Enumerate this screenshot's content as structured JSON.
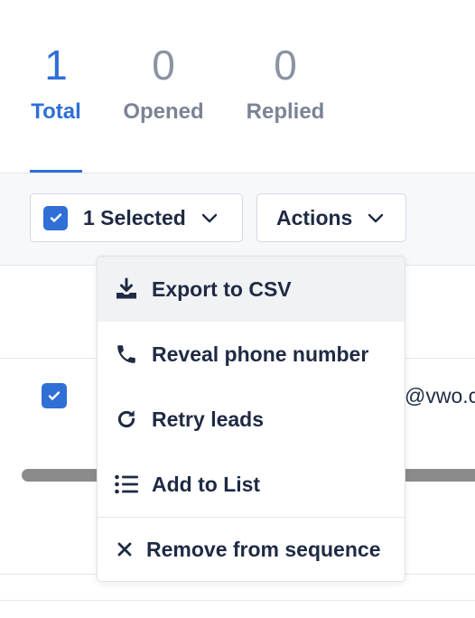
{
  "stats": [
    {
      "count": "1",
      "label": "Total"
    },
    {
      "count": "0",
      "label": "Opened"
    },
    {
      "count": "0",
      "label": "Replied"
    }
  ],
  "toolbar": {
    "selected_label": "1 Selected",
    "actions_label": "Actions"
  },
  "row": {
    "email_fragment": "@vwo.co"
  },
  "menu": {
    "items": [
      {
        "label": "Export to CSV",
        "icon": "download-icon"
      },
      {
        "label": "Reveal phone number",
        "icon": "phone-icon"
      },
      {
        "label": "Retry leads",
        "icon": "retry-icon"
      },
      {
        "label": "Add to List",
        "icon": "list-icon"
      },
      {
        "label": "Remove from sequence",
        "icon": "close-icon"
      }
    ]
  },
  "colors": {
    "accent": "#2f6fd6",
    "text": "#1f2a44",
    "muted": "#7b8494",
    "hover": "#f1f2f4"
  }
}
